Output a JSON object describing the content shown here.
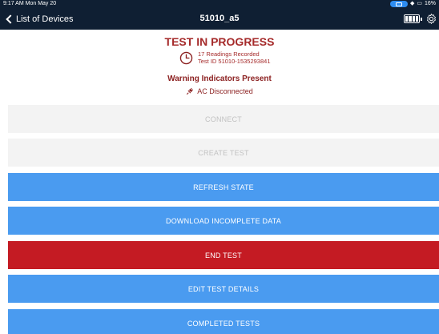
{
  "status_bar": {
    "time": "9:17 AM  Mon May 20",
    "battery_percent": "16%"
  },
  "nav": {
    "back_label": "List of Devices",
    "title": "51010_a5"
  },
  "test_status": {
    "title": "TEST IN PROGRESS",
    "readings": "17 Readings Recorded",
    "test_id": "Test ID 51010-1535293841",
    "warning_title": "Warning Indicators Present",
    "ac_status": "AC Disconnected"
  },
  "buttons": {
    "connect": "CONNECT",
    "create_test": "CREATE TEST",
    "refresh_state": "REFRESH STATE",
    "download_incomplete": "DOWNLOAD INCOMPLETE DATA",
    "end_test": "END TEST",
    "edit_test_details": "EDIT TEST DETAILS",
    "completed_tests": "COMPLETED TESTS"
  },
  "colors": {
    "nav_bg": "#0f1f33",
    "accent_blue": "#4a9bf0",
    "danger_red": "#c41b23",
    "status_text": "#a52a2a"
  },
  "icons": [
    "wifi-icon",
    "cast-icon",
    "battery-icon",
    "gear-icon",
    "clock-icon",
    "plug-icon",
    "chevron-left-icon"
  ]
}
